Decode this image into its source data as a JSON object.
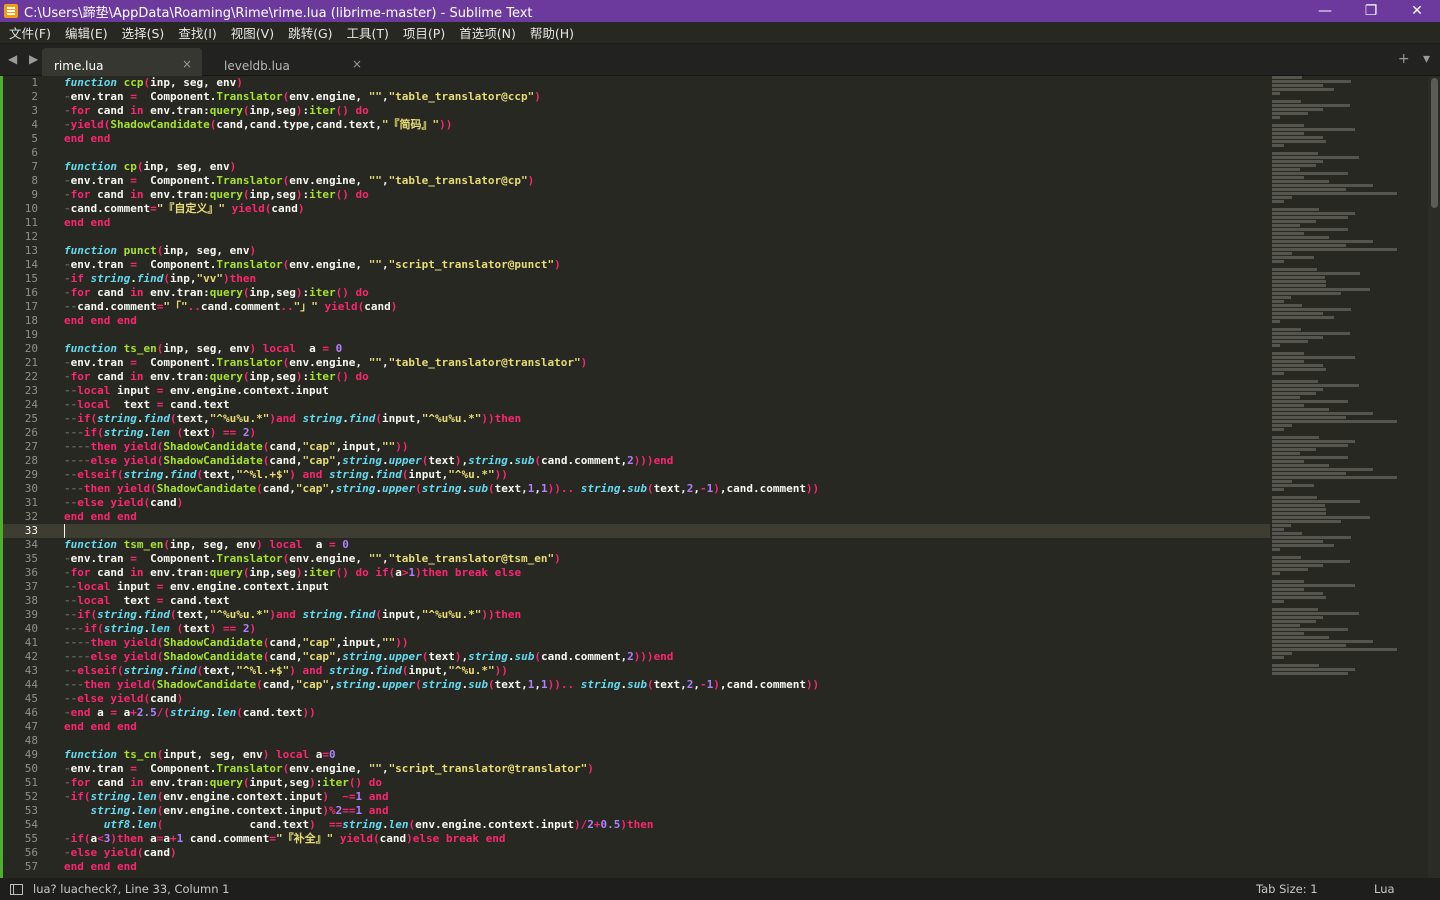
{
  "window": {
    "title": "C:\\Users\\蹄垫\\AppData\\Roaming\\Rime\\rime.lua (librime-master) - Sublime Text",
    "minimize": "—",
    "maximize": "❐",
    "close": "✕"
  },
  "menu": [
    "文件(F)",
    "编辑(E)",
    "选择(S)",
    "查找(I)",
    "视图(V)",
    "跳转(G)",
    "工具(T)",
    "项目(P)",
    "首选项(N)",
    "帮助(H)"
  ],
  "tabs": [
    {
      "label": "rime.lua",
      "close": "×"
    },
    {
      "label": "leveldb.lua",
      "close": "×"
    }
  ],
  "tabbar": {
    "nav": "◀ ▶",
    "add": "+",
    "more": "▾"
  },
  "editor": {
    "current_line": 33,
    "lines": [
      "<span class='ty'>function</span> <span class='fn'>ccp</span><span class='br'>(</span>inp, seg, env<span class='br'>)</span>",
      "·env.tran <span class='op'>=</span>  Component.<span class='fn'>Translator</span><span class='br'>(</span>env.engine, <span class='st'>\"\"</span>,<span class='st'>\"table_translator@ccp\"</span><span class='br'>)</span>",
      "·<span class='kw'>for</span> cand <span class='kw'>in</span> env.tran:<span class='fn'>query</span><span class='br'>(</span>inp,seg<span class='br'>)</span>:<span class='fn'>iter</span><span class='br'>()</span> <span class='kw'>do</span>",
      "·<span class='kw'>yield</span><span class='br'>(</span><span class='fn'>ShadowCandidate</span><span class='br'>(</span>cand,cand.type,cand.text,<span class='st'>\"『简码』\"</span><span class='br'>))</span>",
      "<span class='kw'>end end</span>",
      "",
      "<span class='ty'>function</span> <span class='fn'>cp</span><span class='br'>(</span>inp, seg, env<span class='br'>)</span>",
      "·env.tran <span class='op'>=</span>  Component.<span class='fn'>Translator</span><span class='br'>(</span>env.engine, <span class='st'>\"\"</span>,<span class='st'>\"table_translator@cp\"</span><span class='br'>)</span>",
      "·<span class='kw'>for</span> cand <span class='kw'>in</span> env.tran:<span class='fn'>query</span><span class='br'>(</span>inp,seg<span class='br'>)</span>:<span class='fn'>iter</span><span class='br'>()</span> <span class='kw'>do</span>",
      "·cand.comment<span class='op'>=</span><span class='st'>\"『自定义』\"</span> <span class='kw'>yield</span><span class='br'>(</span>cand<span class='br'>)</span>",
      "<span class='kw'>end end</span>",
      "",
      "<span class='ty'>function</span> <span class='fn'>punct</span><span class='br'>(</span>inp, seg, env<span class='br'>)</span>",
      "·env.tran <span class='op'>=</span>  Component.<span class='fn'>Translator</span><span class='br'>(</span>env.engine, <span class='st'>\"\"</span>,<span class='st'>\"script_translator@punct\"</span><span class='br'>)</span>",
      "·<span class='kw'>if</span> <span class='ty'>string</span>.<span class='ty'>find</span><span class='br'>(</span>inp,<span class='st'>\"vv\"</span><span class='br'>)</span><span class='kw'>then</span>",
      "·<span class='kw'>for</span> cand <span class='kw'>in</span> env.tran:<span class='fn'>query</span><span class='br'>(</span>inp,seg<span class='br'>)</span>:<span class='fn'>iter</span><span class='br'>()</span> <span class='kw'>do</span>",
      "··cand.comment<span class='op'>=</span><span class='st'>\"「\"</span><span class='op'>..</span>cand.comment<span class='op'>..</span><span class='st'>\"」\"</span> <span class='kw'>yield</span><span class='br'>(</span>cand<span class='br'>)</span>",
      "<span class='kw'>end end end</span>",
      "",
      "<span class='ty'>function</span> <span class='fn'>ts_en</span><span class='br'>(</span>inp, seg, env<span class='br'>)</span> <span class='kw'>local</span>  a <span class='op'>=</span> <span class='nm'>0</span>",
      "·env.tran <span class='op'>=</span>  Component.<span class='fn'>Translator</span><span class='br'>(</span>env.engine, <span class='st'>\"\"</span>,<span class='st'>\"table_translator@translator\"</span><span class='br'>)</span>",
      "·<span class='kw'>for</span> cand <span class='kw'>in</span> env.tran:<span class='fn'>query</span><span class='br'>(</span>inp,seg<span class='br'>)</span>:<span class='fn'>iter</span><span class='br'>()</span> <span class='kw'>do</span>",
      "··<span class='kw'>local</span> input <span class='op'>=</span> env.engine.context.input",
      "··<span class='kw'>local</span>  text <span class='op'>=</span> cand.text",
      "··<span class='kw'>if</span><span class='br'>(</span><span class='ty'>string</span>.<span class='ty'>find</span><span class='br'>(</span>text,<span class='st'>\"^%u%u.*\"</span><span class='br'>)</span><span class='kw'>and</span> <span class='ty'>string</span>.<span class='ty'>find</span><span class='br'>(</span>input,<span class='st'>\"^%u%u.*\"</span><span class='br'>))</span><span class='kw'>then</span>",
      "···<span class='kw'>if</span><span class='br'>(</span><span class='ty'>string</span>.<span class='ty'>len</span> <span class='br'>(</span>text<span class='br'>)</span> <span class='op'>==</span> <span class='nm'>2</span><span class='br'>)</span>",
      "····<span class='kw'>then</span> <span class='kw'>yield</span><span class='br'>(</span><span class='fn'>ShadowCandidate</span><span class='br'>(</span>cand,<span class='st'>\"cap\"</span>,input,<span class='st'>\"\"</span><span class='br'>))</span>",
      "····<span class='kw'>else</span> <span class='kw'>yield</span><span class='br'>(</span><span class='fn'>ShadowCandidate</span><span class='br'>(</span>cand,<span class='st'>\"cap\"</span>,<span class='ty'>string</span>.<span class='ty'>upper</span><span class='br'>(</span>text<span class='br'>)</span>,<span class='ty'>string</span>.<span class='ty'>sub</span><span class='br'>(</span>cand.comment,<span class='nm'>2</span><span class='br'>)))</span><span class='kw'>end</span>",
      "··<span class='kw'>elseif</span><span class='br'>(</span><span class='ty'>string</span>.<span class='ty'>find</span><span class='br'>(</span>text,<span class='st'>\"^%l.+$\"</span><span class='br'>)</span> <span class='kw'>and</span> <span class='ty'>string</span>.<span class='ty'>find</span><span class='br'>(</span>input,<span class='st'>\"^%u.*\"</span><span class='br'>))</span>",
      "···<span class='kw'>then</span> <span class='kw'>yield</span><span class='br'>(</span><span class='fn'>ShadowCandidate</span><span class='br'>(</span>cand,<span class='st'>\"cap\"</span>,<span class='ty'>string</span>.<span class='ty'>upper</span><span class='br'>(</span><span class='ty'>string</span>.<span class='ty'>sub</span><span class='br'>(</span>text,<span class='nm'>1</span>,<span class='nm'>1</span><span class='br'>))</span><span class='op'>..</span> <span class='ty'>string</span>.<span class='ty'>sub</span><span class='br'>(</span>text,<span class='nm'>2</span>,<span class='op'>-</span><span class='nm'>1</span><span class='br'>)</span>,cand.comment<span class='br'>))</span>",
      "··<span class='kw'>else</span> <span class='kw'>yield</span><span class='br'>(</span>cand<span class='br'>)</span>",
      "<span class='kw'>end end end</span>",
      "",
      "<span class='ty'>function</span> <span class='fn'>tsm_en</span><span class='br'>(</span>inp, seg, env<span class='br'>)</span> <span class='kw'>local</span>  a <span class='op'>=</span> <span class='nm'>0</span>",
      "·env.tran <span class='op'>=</span>  Component.<span class='fn'>Translator</span><span class='br'>(</span>env.engine, <span class='st'>\"\"</span>,<span class='st'>\"table_translator@tsm_en\"</span><span class='br'>)</span>",
      "·<span class='kw'>for</span> cand <span class='kw'>in</span> env.tran:<span class='fn'>query</span><span class='br'>(</span>inp,seg<span class='br'>)</span>:<span class='fn'>iter</span><span class='br'>()</span> <span class='kw'>do</span> <span class='kw'>if</span><span class='br'>(</span>a<span class='op'>></span><span class='nm'>1</span><span class='br'>)</span><span class='kw'>then</span> <span class='kw'>break</span> <span class='kw'>else</span>",
      "··<span class='kw'>local</span> input <span class='op'>=</span> env.engine.context.input",
      "··<span class='kw'>local</span>  text <span class='op'>=</span> cand.text",
      "··<span class='kw'>if</span><span class='br'>(</span><span class='ty'>string</span>.<span class='ty'>find</span><span class='br'>(</span>text,<span class='st'>\"^%u%u.*\"</span><span class='br'>)</span><span class='kw'>and</span> <span class='ty'>string</span>.<span class='ty'>find</span><span class='br'>(</span>input,<span class='st'>\"^%u%u.*\"</span><span class='br'>))</span><span class='kw'>then</span>",
      "···<span class='kw'>if</span><span class='br'>(</span><span class='ty'>string</span>.<span class='ty'>len</span> <span class='br'>(</span>text<span class='br'>)</span> <span class='op'>==</span> <span class='nm'>2</span><span class='br'>)</span>",
      "····<span class='kw'>then</span> <span class='kw'>yield</span><span class='br'>(</span><span class='fn'>ShadowCandidate</span><span class='br'>(</span>cand,<span class='st'>\"cap\"</span>,input,<span class='st'>\"\"</span><span class='br'>))</span>",
      "····<span class='kw'>else</span> <span class='kw'>yield</span><span class='br'>(</span><span class='fn'>ShadowCandidate</span><span class='br'>(</span>cand,<span class='st'>\"cap\"</span>,<span class='ty'>string</span>.<span class='ty'>upper</span><span class='br'>(</span>text<span class='br'>)</span>,<span class='ty'>string</span>.<span class='ty'>sub</span><span class='br'>(</span>cand.comment,<span class='nm'>2</span><span class='br'>)))</span><span class='kw'>end</span>",
      "··<span class='kw'>elseif</span><span class='br'>(</span><span class='ty'>string</span>.<span class='ty'>find</span><span class='br'>(</span>text,<span class='st'>\"^%l.+$\"</span><span class='br'>)</span> <span class='kw'>and</span> <span class='ty'>string</span>.<span class='ty'>find</span><span class='br'>(</span>input,<span class='st'>\"^%u.*\"</span><span class='br'>))</span>",
      "···<span class='kw'>then</span> <span class='kw'>yield</span><span class='br'>(</span><span class='fn'>ShadowCandidate</span><span class='br'>(</span>cand,<span class='st'>\"cap\"</span>,<span class='ty'>string</span>.<span class='ty'>upper</span><span class='br'>(</span><span class='ty'>string</span>.<span class='ty'>sub</span><span class='br'>(</span>text,<span class='nm'>1</span>,<span class='nm'>1</span><span class='br'>))</span><span class='op'>..</span> <span class='ty'>string</span>.<span class='ty'>sub</span><span class='br'>(</span>text,<span class='nm'>2</span>,<span class='op'>-</span><span class='nm'>1</span><span class='br'>)</span>,cand.comment<span class='br'>))</span>",
      "··<span class='kw'>else</span> <span class='kw'>yield</span><span class='br'>(</span>cand<span class='br'>)</span>",
      "·<span class='kw'>end</span> a <span class='op'>=</span> a<span class='op'>+</span><span class='nm'>2.5</span><span class='op'>/</span><span class='br'>(</span><span class='ty'>string</span>.<span class='ty'>len</span><span class='br'>(</span>cand.text<span class='br'>))</span>",
      "<span class='kw'>end end end</span>",
      "",
      "<span class='ty'>function</span> <span class='fn'>ts_cn</span><span class='br'>(</span>input, seg, env<span class='br'>)</span> <span class='kw'>local</span> a<span class='op'>=</span><span class='nm'>0</span>",
      "·env.tran <span class='op'>=</span>  Component.<span class='fn'>Translator</span><span class='br'>(</span>env.engine, <span class='st'>\"\"</span>,<span class='st'>\"script_translator@translator\"</span><span class='br'>)</span>",
      "·<span class='kw'>for</span> cand <span class='kw'>in</span> env.tran:<span class='fn'>query</span><span class='br'>(</span>input,seg<span class='br'>)</span>:<span class='fn'>iter</span><span class='br'>()</span> <span class='kw'>do</span>",
      "·<span class='kw'>if</span><span class='br'>(</span><span class='ty'>string</span>.<span class='ty'>len</span><span class='br'>(</span>env.engine.context.input<span class='br'>)</span>  <span class='op'>~=</span><span class='nm'>1</span> <span class='kw'>and</span>",
      "    <span class='ty'>string</span>.<span class='ty'>len</span><span class='br'>(</span>env.engine.context.input<span class='br'>)</span><span class='op'>%</span><span class='nm'>2</span><span class='op'>==</span><span class='nm'>1</span> <span class='kw'>and</span>",
      "      <span class='ty'>utf8</span>.<span class='ty'>len</span><span class='br'>(</span>             cand.text<span class='br'>)</span>  <span class='op'>==</span><span class='ty'>string</span>.<span class='ty'>len</span><span class='br'>(</span>env.engine.context.input<span class='br'>)</span><span class='op'>/</span><span class='nm'>2</span><span class='op'>+</span><span class='nm'>0.5</span><span class='br'>)</span><span class='kw'>then</span>",
      "·<span class='kw'>if</span><span class='br'>(</span>a<span class='op'><</span><span class='nm'>3</span><span class='br'>)</span><span class='kw'>then</span> a<span class='op'>=</span>a<span class='op'>+</span><span class='nm'>1</span> cand.comment<span class='op'>=</span><span class='st'>\"『补全』\"</span> <span class='kw'>yield</span><span class='br'>(</span>cand<span class='br'>)</span><span class='kw'>else</span> <span class='kw'>break</span> <span class='kw'>end</span>",
      "·<span class='kw'>else</span> <span class='kw'>yield</span><span class='br'>(</span>cand<span class='br'>)</span>",
      "<span class='kw'>end end end</span>"
    ]
  },
  "status": {
    "message": "lua? luacheck?, Line 33, Column 1",
    "tab_size": "Tab Size: 1",
    "syntax": "Lua"
  }
}
